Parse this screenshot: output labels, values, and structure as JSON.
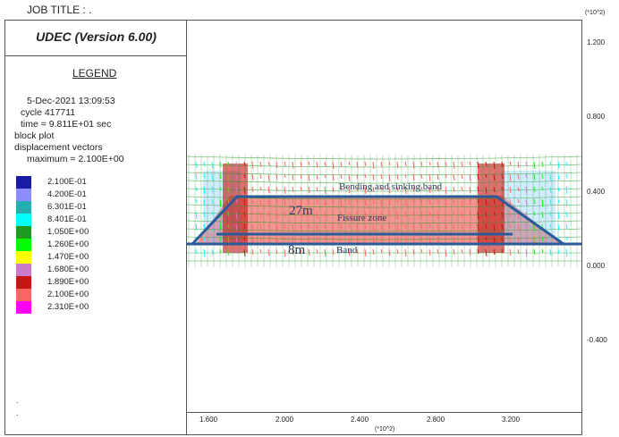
{
  "header": {
    "job_title": "JOB TITLE : .",
    "scale_note": "(*10^2)"
  },
  "app": {
    "title": "UDEC (Version 6.00)"
  },
  "legend": {
    "heading": "LEGEND",
    "date_time": "5-Dec-2021  13:09:53",
    "cycle_line": "cycle   417711",
    "time_line": "time  =  9.811E+01 sec",
    "plot_type": "block plot",
    "vector_type": "displacement vectors",
    "maximum_line": "maximum =     2.100E+00",
    "classes": [
      {
        "label": "2.100E-01",
        "color": "#1a1aa8"
      },
      {
        "label": "4.200E-01",
        "color": "#8c8cff"
      },
      {
        "label": "6.301E-01",
        "color": "#20b0b0"
      },
      {
        "label": "8.401E-01",
        "color": "#00ffff"
      },
      {
        "label": "1.050E+00",
        "color": "#1e9a1e"
      },
      {
        "label": "1.260E+00",
        "color": "#00ff00"
      },
      {
        "label": "1.470E+00",
        "color": "#ffff00"
      },
      {
        "label": "1.680E+00",
        "color": "#cc7acc"
      },
      {
        "label": "1.890E+00",
        "color": "#c81414"
      },
      {
        "label": "2.100E+00",
        "color": "#ff6464"
      },
      {
        "label": "2.310E+00",
        "color": "#ff00ff"
      }
    ],
    "footer_marks": [
      ".",
      "."
    ]
  },
  "axes": {
    "x_ticks": [
      "1.600",
      "2.000",
      "2.400",
      "2.800",
      "3.200"
    ],
    "x_unit": "(*10^2)",
    "y_ticks": [
      "1.200",
      "0.800",
      "0.400",
      "0.000",
      "-0.400"
    ],
    "y_unit": "(*10^2)"
  },
  "annotations": {
    "bending_band": "Bending and sinking band",
    "fissure_zone": "Fissure zone",
    "band": "Band",
    "height_27": "27m",
    "height_8": "8m"
  },
  "colors": {
    "outline": "#2a5a9a",
    "grid": "#1e9a1e",
    "fissure": "#f48080",
    "core": "#c81414"
  }
}
